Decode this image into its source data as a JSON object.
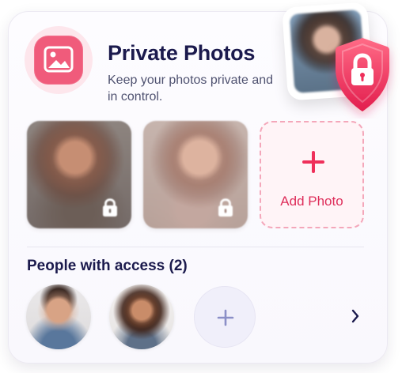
{
  "card": {
    "title": "Private Photos",
    "subtitle": "Keep your photos private and in control."
  },
  "icons": {
    "header": "image-icon",
    "security": "shield-lock-icon",
    "locked_photo": "lock-icon",
    "add_photo": "plus-icon",
    "add_person": "plus-icon",
    "next": "chevron-right-icon"
  },
  "photos": {
    "add_label": "Add Photo"
  },
  "access": {
    "title": "People with access (2)"
  },
  "colors": {
    "accent": "#EF2F5A",
    "accent_soft": "#FDE6EC",
    "title": "#1B1A4D",
    "muted": "#4F5270",
    "add_tint": "#8B8FC7"
  }
}
